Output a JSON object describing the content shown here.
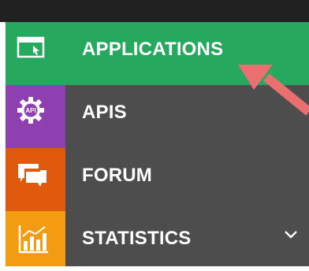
{
  "nav": {
    "items": [
      {
        "label": "APPLICATIONS",
        "icon": "application-window-icon",
        "accent": "#26a95f",
        "active": true
      },
      {
        "label": "APIS",
        "icon": "api-gear-icon",
        "accent": "#8e3fb0",
        "active": false
      },
      {
        "label": "FORUM",
        "icon": "chat-bubbles-icon",
        "accent": "#e05a0d",
        "active": false
      },
      {
        "label": "STATISTICS",
        "icon": "bar-chart-icon",
        "accent": "#f39c12",
        "active": false,
        "expandable": true
      }
    ]
  },
  "icons": {
    "api_badge_text": "API"
  },
  "colors": {
    "topbar": "#212121",
    "menu_bg": "#4d4d4d",
    "active_bg": "#26a95f",
    "arrow": "#ea6f6f"
  }
}
